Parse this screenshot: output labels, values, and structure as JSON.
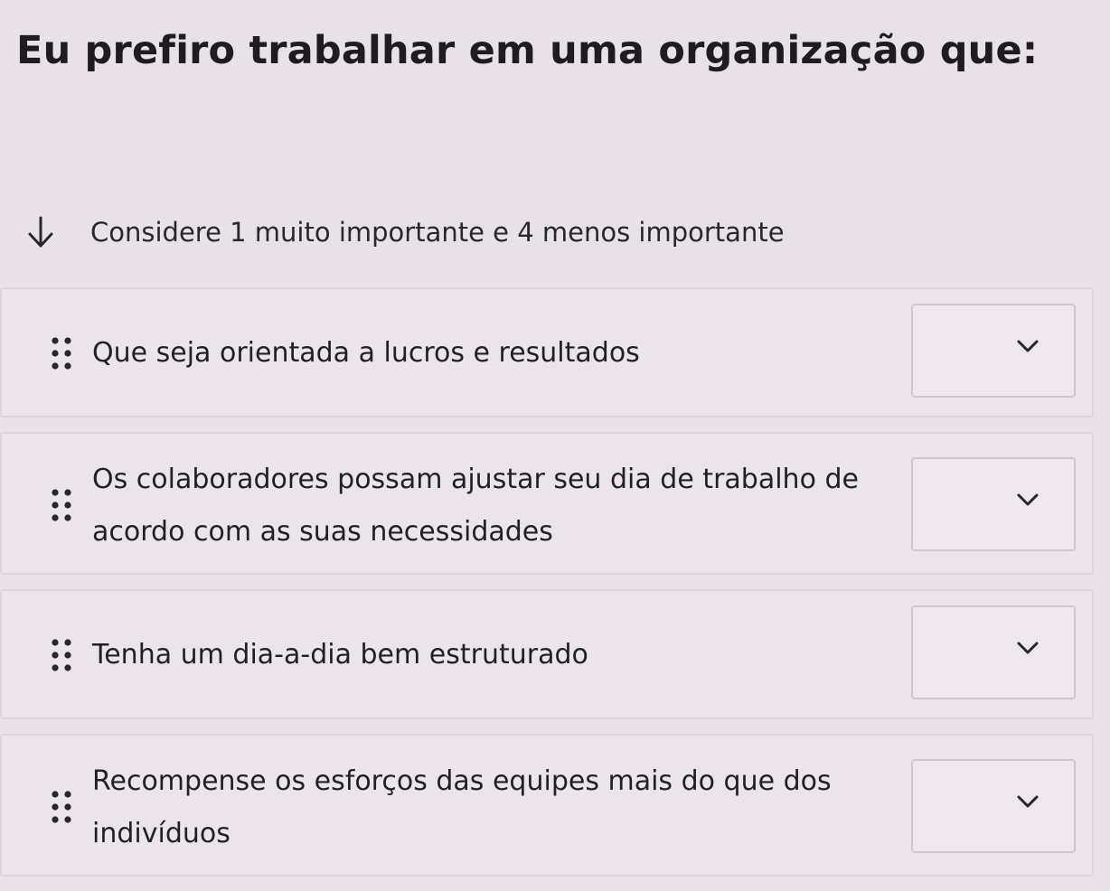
{
  "question": {
    "title": "Eu prefiro trabalhar em uma organização que:",
    "instruction": "Considere 1 muito importante e 4 menos importante"
  },
  "items": [
    {
      "label": "Que seja orientada a lucros e resultados",
      "rank": ""
    },
    {
      "label": "Os colaboradores possam ajustar seu dia de trabalho de acordo com as suas necessidades",
      "rank": ""
    },
    {
      "label": "Tenha um dia-a-dia bem estruturado",
      "rank": ""
    },
    {
      "label": "Recompense os esforços das equipes mais do que dos indivíduos",
      "rank": ""
    }
  ],
  "icons": {
    "instruction": "arrow-down-icon",
    "handle": "drag-handle-icon",
    "select": "chevron-down-icon"
  }
}
